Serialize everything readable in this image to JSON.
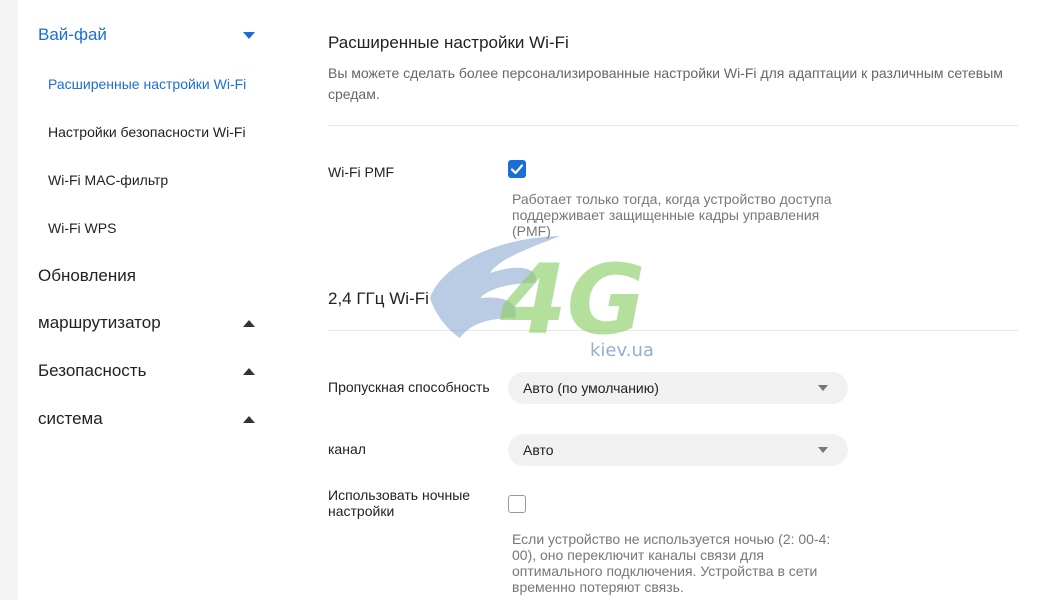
{
  "sidebar": {
    "sections": [
      {
        "label": "Вай-фай",
        "state": "expanded",
        "active": true
      },
      {
        "label": "Обновления"
      },
      {
        "label": "маршрутизатор",
        "state": "collapsed"
      },
      {
        "label": "Безопасность",
        "state": "collapsed"
      },
      {
        "label": "система",
        "state": "collapsed"
      }
    ],
    "wifi_items": [
      {
        "label": "Расширенные настройки Wi-Fi",
        "active": true
      },
      {
        "label": "Настройки безопасности Wi-Fi"
      },
      {
        "label": "Wi-Fi MAC-фильтр"
      },
      {
        "label": "Wi-Fi WPS"
      }
    ]
  },
  "main": {
    "title": "Расширенные настройки Wi-Fi",
    "description": "Вы можете сделать более персонализированные настройки Wi-Fi для адаптации к различным сетевым средам.",
    "pmf": {
      "label": "Wi-Fi PMF",
      "checked": true,
      "hint": "Работает только тогда, когда устройство доступа поддерживает защищенные кадры управления (PMF)"
    },
    "band_title": "2,4 ГГц Wi-Fi",
    "bandwidth": {
      "label": "Пропускная способность",
      "value": "Авто (по умолчанию)"
    },
    "channel": {
      "label": "канал",
      "value": "Авто"
    },
    "night": {
      "label": "Использовать ночные настройки",
      "checked": false,
      "hint": "Если устройство не используется ночью (2: 00-4: 00), оно переключит каналы связи для оптимального подключения. Устройства в сети временно потеряют связь."
    }
  },
  "watermark": {
    "logo_text": "4G",
    "site": "kiev.ua"
  },
  "colors": {
    "accent": "#1a6fd4",
    "page_bg": "#f3f3f3",
    "panel_bg": "#ffffff"
  }
}
